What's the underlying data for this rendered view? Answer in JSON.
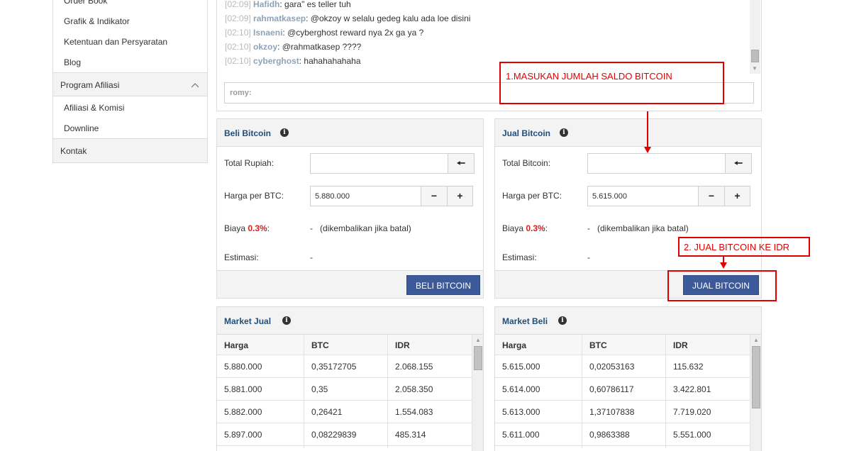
{
  "sidebar": {
    "items_top": [
      "Order Book",
      "Grafik & Indikator",
      "Ketentuan dan Persyaratan",
      "Blog"
    ],
    "group_affiliate": "Program Afiliasi",
    "items_affiliate": [
      "Afiliasi & Komisi",
      "Downline"
    ],
    "group_contact": "Kontak"
  },
  "chat": {
    "messages": [
      {
        "time": "[02:09]",
        "user": "Hafidh",
        "text": ": gara\" es teller tuh"
      },
      {
        "time": "[02:09]",
        "user": "rahmatkasep",
        "text": ": @okzoy w selalu gedeg kalu ada loe disini"
      },
      {
        "time": "[02:10]",
        "user": "Isnaeni",
        "text": ": @cyberghost reward nya 2x ga ya ?"
      },
      {
        "time": "[02:10]",
        "user": "okzoy",
        "text": ": @rahmatkasep ????"
      },
      {
        "time": "[02:10]",
        "user": "cyberghost",
        "text": ": hahahahahaha"
      }
    ],
    "input_label": "romy:"
  },
  "buy": {
    "title": "Beli Bitcoin",
    "total_label": "Total Rupiah:",
    "total_value": "",
    "price_label": "Harga per BTC:",
    "price_value": "5.880.000",
    "fee_label_prefix": "Biaya ",
    "fee_pct": "0.3%",
    "fee_label_suffix": ":",
    "fee_value": "-",
    "fee_note": "(dikembalikan jika batal)",
    "est_label": "Estimasi:",
    "est_value": "-",
    "button": "BELI BITCOIN",
    "minus": "−",
    "plus": "+"
  },
  "sell": {
    "title": "Jual Bitcoin",
    "total_label": "Total Bitcoin:",
    "total_value": "",
    "price_label": "Harga per BTC:",
    "price_value": "5.615.000",
    "fee_label_prefix": "Biaya ",
    "fee_pct": "0.3%",
    "fee_label_suffix": ":",
    "fee_value": "-",
    "fee_note": "(dikembalikan jika batal)",
    "est_label": "Estimasi:",
    "est_value": "-",
    "button": "JUAL BITCOIN",
    "minus": "−",
    "plus": "+"
  },
  "market_sell": {
    "title": "Market Jual",
    "headers": [
      "Harga",
      "BTC",
      "IDR"
    ],
    "rows": [
      [
        "5.880.000",
        "0,35172705",
        "2.068.155"
      ],
      [
        "5.881.000",
        "0,35",
        "2.058.350"
      ],
      [
        "5.882.000",
        "0,26421",
        "1.554.083"
      ],
      [
        "5.897.000",
        "0,08229839",
        "485.314"
      ]
    ]
  },
  "market_buy": {
    "title": "Market Beli",
    "headers": [
      "Harga",
      "BTC",
      "IDR"
    ],
    "rows": [
      [
        "5.615.000",
        "0,02053163",
        "115.632"
      ],
      [
        "5.614.000",
        "0,60786117",
        "3.422.801"
      ],
      [
        "5.613.000",
        "1,37107838",
        "7.719.020"
      ],
      [
        "5.611.000",
        "0,9863388",
        "5.551.000"
      ]
    ]
  },
  "annotations": {
    "step1": "1.MASUKAN JUMLAH SALDO BITCOIN",
    "step2": "2. JUAL BITCOIN KE IDR",
    "color": "#e00000"
  },
  "icons": {
    "info": "i",
    "back": "🠔"
  }
}
